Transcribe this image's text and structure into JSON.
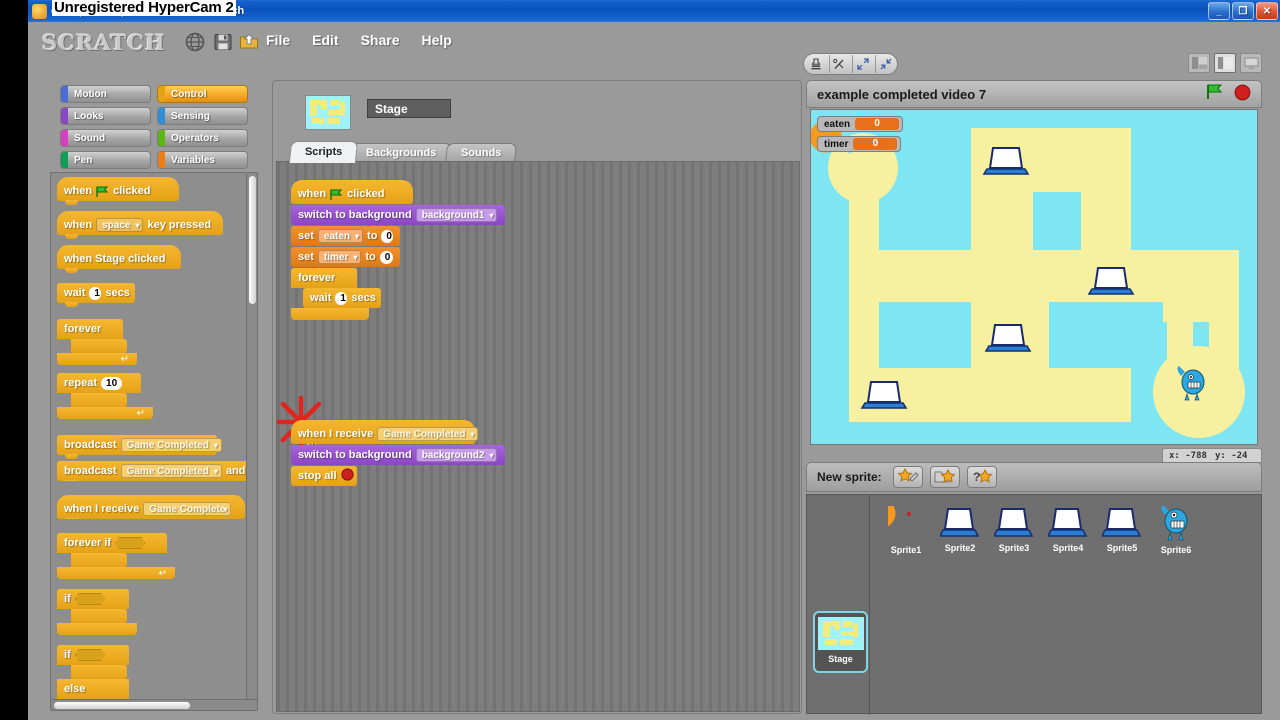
{
  "window": {
    "title": "example completed video 7 - Scratch",
    "watermark": "Unregistered HyperCam 2",
    "buttons": {
      "minimize": "_",
      "restore": "❐",
      "close": "✕"
    }
  },
  "menubar": {
    "logo": "SCRATCH",
    "icons": [
      "globe-icon",
      "save-icon",
      "share-icon"
    ],
    "items": [
      "File",
      "Edit",
      "Share",
      "Help"
    ],
    "tools": [
      "stamp-icon",
      "scissors-icon",
      "grow-icon",
      "shrink-icon"
    ],
    "views": [
      "small-stage-layout",
      "normal-stage-layout",
      "presentation-mode"
    ]
  },
  "palette": {
    "categories": [
      {
        "name": "Motion",
        "color": "#4a6cd4",
        "active": false
      },
      {
        "name": "Control",
        "color": "#e5a217",
        "active": true
      },
      {
        "name": "Looks",
        "color": "#8a46c4",
        "active": false
      },
      {
        "name": "Sensing",
        "color": "#2f8ed6",
        "active": false
      },
      {
        "name": "Sound",
        "color": "#d63ec4",
        "active": false
      },
      {
        "name": "Operators",
        "color": "#5cb712",
        "active": false
      },
      {
        "name": "Pen",
        "color": "#0f9d58",
        "active": false
      },
      {
        "name": "Variables",
        "color": "#ee7d16",
        "active": false
      }
    ],
    "blocks": [
      {
        "id": "when-flag-clicked",
        "parts": [
          "when",
          "green-flag",
          "clicked"
        ]
      },
      {
        "id": "when-key-pressed",
        "parts": [
          "when",
          "space",
          "key pressed"
        ]
      },
      {
        "id": "when-stage-clicked",
        "parts": [
          "when Stage clicked"
        ]
      },
      {
        "id": "wait-secs",
        "parts": [
          "wait",
          "1",
          "secs"
        ]
      },
      {
        "id": "forever",
        "parts": [
          "forever"
        ]
      },
      {
        "id": "repeat",
        "parts": [
          "repeat",
          "10"
        ]
      },
      {
        "id": "broadcast",
        "parts": [
          "broadcast",
          "Game Completed"
        ]
      },
      {
        "id": "broadcast-and-wait",
        "parts": [
          "broadcast",
          "Game Completed",
          "and wait"
        ]
      },
      {
        "id": "when-i-receive",
        "parts": [
          "when I receive",
          "Game Complete"
        ]
      },
      {
        "id": "forever-if",
        "parts": [
          "forever if"
        ]
      },
      {
        "id": "if",
        "parts": [
          "if"
        ]
      },
      {
        "id": "if-else",
        "parts": [
          "if",
          "else"
        ]
      }
    ],
    "labels": {
      "when": "when",
      "clicked": "clicked",
      "space": "space",
      "key_pressed": "key pressed",
      "when_stage_clicked": "when Stage clicked",
      "wait": "wait",
      "one": "1",
      "secs": "secs",
      "forever": "forever",
      "repeat": "repeat",
      "ten": "10",
      "broadcast": "broadcast",
      "game_completed": "Game Completed",
      "and_wait": "and wait",
      "when_i_receive": "when I receive",
      "game_complete_trunc": "Game Complete",
      "forever_if": "forever if",
      "if": "if",
      "else": "else"
    }
  },
  "scripts_panel": {
    "sprite_name": "Stage",
    "tabs": [
      {
        "label": "Scripts",
        "active": true
      },
      {
        "label": "Backgrounds",
        "active": false
      },
      {
        "label": "Sounds",
        "active": false
      }
    ],
    "script1": {
      "hat": {
        "when": "when",
        "flag": "green-flag",
        "clicked": "clicked"
      },
      "rows": [
        {
          "type": "looks",
          "label": "switch to background",
          "value": "background1"
        },
        {
          "type": "vars",
          "label": "set",
          "var": "eaten",
          "to": "to",
          "value": "0"
        },
        {
          "type": "vars",
          "label": "set",
          "var": "timer",
          "to": "to",
          "value": "0"
        },
        {
          "type": "ctrl",
          "label": "forever"
        },
        {
          "type": "ctrl",
          "label": "wait",
          "value": "1",
          "unit": "secs"
        }
      ]
    },
    "script2": {
      "hat": {
        "label": "when I receive",
        "value": "Game Completed"
      },
      "rows": [
        {
          "type": "looks",
          "label": "switch to background",
          "value": "background2"
        },
        {
          "type": "ctrl",
          "label": "stop all"
        }
      ]
    }
  },
  "stage": {
    "project_title": "example completed video 7",
    "green_flag": "green-flag-icon",
    "stop_button": "stop-icon",
    "watchers": [
      {
        "name": "eaten",
        "value": "0"
      },
      {
        "name": "timer",
        "value": "0"
      }
    ],
    "coords": {
      "x_label": "x:",
      "x": "-788",
      "y_label": "y:",
      "y": "-24"
    },
    "background_color": "#7ee6f2",
    "maze_color": "#f7f0a0"
  },
  "sprite_pane": {
    "new_sprite_label": "New sprite:",
    "new_sprite_buttons": [
      "paint-new-sprite",
      "choose-new-sprite",
      "random-new-sprite"
    ],
    "stage_cell": {
      "label": "Stage",
      "selected": true
    },
    "sprites": [
      {
        "name": "Sprite1",
        "icon": "pacman-icon"
      },
      {
        "name": "Sprite2",
        "icon": "laptop-icon"
      },
      {
        "name": "Sprite3",
        "icon": "laptop-icon"
      },
      {
        "name": "Sprite4",
        "icon": "laptop-icon"
      },
      {
        "name": "Sprite5",
        "icon": "laptop-icon"
      },
      {
        "name": "Sprite6",
        "icon": "monster-icon"
      }
    ]
  }
}
